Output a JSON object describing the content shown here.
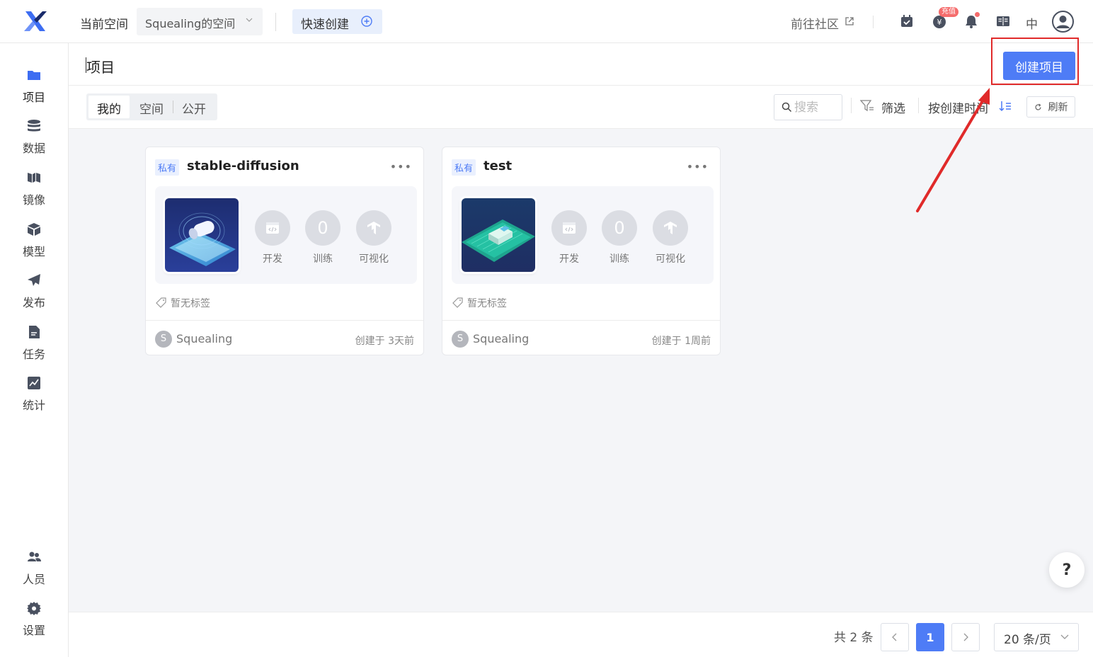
{
  "header": {
    "space_label": "当前空间",
    "space_selected": "Squealing的空间",
    "quick_create": "快速创建",
    "community": "前往社区",
    "recharge_badge": "充值",
    "lang": "中"
  },
  "sidebar": {
    "items": [
      {
        "label": "项目",
        "icon": "folder-icon"
      },
      {
        "label": "数据",
        "icon": "database-icon"
      },
      {
        "label": "镜像",
        "icon": "image-icon"
      },
      {
        "label": "模型",
        "icon": "cube-icon"
      },
      {
        "label": "发布",
        "icon": "paper-plane-icon"
      },
      {
        "label": "任务",
        "icon": "task-icon"
      },
      {
        "label": "统计",
        "icon": "chart-icon"
      }
    ],
    "bottom": [
      {
        "label": "人员",
        "icon": "users-icon"
      },
      {
        "label": "设置",
        "icon": "gear-icon"
      }
    ]
  },
  "page": {
    "title": "项目",
    "create_button": "创建项目"
  },
  "filters": {
    "tabs": [
      "我的",
      "空间",
      "公开"
    ],
    "active_tab": "我的",
    "search_placeholder": "搜索",
    "filter_label": "筛选",
    "sort_label": "按创建时间",
    "refresh_label": "刷新"
  },
  "projects": [
    {
      "visibility": "私有",
      "name": "stable-diffusion",
      "actions": [
        "开发",
        "训练",
        "可视化"
      ],
      "train_count": "0",
      "tags_text": "暂无标签",
      "owner_initial": "S",
      "owner": "Squealing",
      "created": "创建于 3天前"
    },
    {
      "visibility": "私有",
      "name": "test",
      "actions": [
        "开发",
        "训练",
        "可视化"
      ],
      "train_count": "0",
      "tags_text": "暂无标签",
      "owner_initial": "S",
      "owner": "Squealing",
      "created": "创建于 1周前"
    }
  ],
  "pagination": {
    "total_text": "共 2 条",
    "current": "1",
    "page_size": "20 条/页"
  },
  "help": "?",
  "colors": {
    "primary": "#4e7cf6",
    "highlight": "#e02a2a",
    "badge": "#f56c6c"
  }
}
